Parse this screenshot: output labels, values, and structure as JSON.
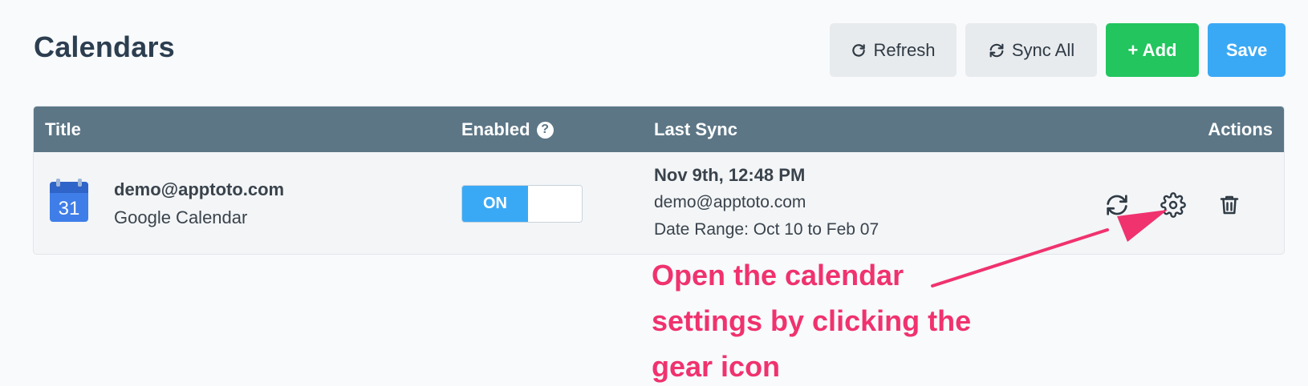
{
  "header": {
    "title": "Calendars"
  },
  "toolbar": {
    "refresh_label": "Refresh",
    "sync_all_label": "Sync All",
    "add_label": "+ Add",
    "save_label": "Save"
  },
  "table": {
    "columns": {
      "title": "Title",
      "enabled": "Enabled",
      "last_sync": "Last Sync",
      "actions": "Actions"
    },
    "rows": [
      {
        "calendar_icon_day": "31",
        "name": "demo@apptoto.com",
        "type": "Google Calendar",
        "enabled_label": "ON",
        "last_sync_date": "Nov 9th, 12:48 PM",
        "last_sync_account": "demo@apptoto.com",
        "date_range": "Date Range: Oct 10 to Feb 07"
      }
    ]
  },
  "annotation": {
    "text": "Open the calendar settings by clicking the gear icon"
  },
  "colors": {
    "header_bg": "#5c7686",
    "add_button": "#22c55e",
    "save_button": "#3aa9f5",
    "annotation": "#f0326e"
  },
  "icons": [
    "refresh-icon",
    "sync-icon",
    "help-icon",
    "google-calendar-icon",
    "sync-icon",
    "gear-icon",
    "trash-icon"
  ]
}
